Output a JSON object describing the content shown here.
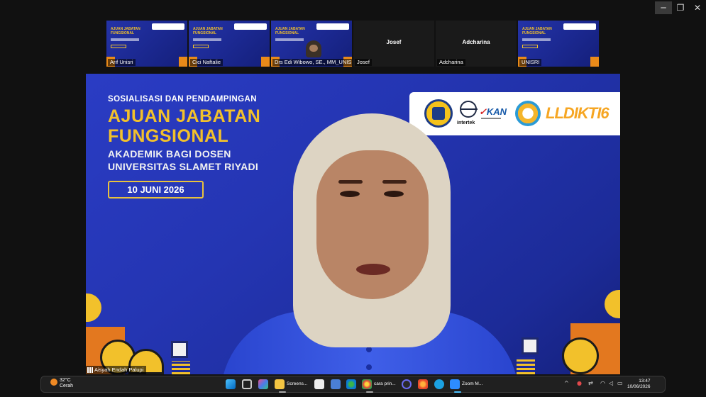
{
  "window_controls": {
    "minimize": "─",
    "restore": "❐",
    "close": "✕"
  },
  "gallery": [
    {
      "name": "Arif Unisri"
    },
    {
      "name": "Cici Naftalie"
    },
    {
      "name": "Drs Edi Wibowo, SE., MM_UNISRI"
    },
    {
      "name": "Josef",
      "display": "Josef"
    },
    {
      "name": "Adcharina",
      "display": "Adcharina"
    },
    {
      "name": "UNISRI"
    }
  ],
  "slide": {
    "kicker": "SOSIALISASI DAN PENDAMPINGAN",
    "title_line1": "AJUAN JABATAN",
    "title_line2": "FUNGSIONAL",
    "sub_line1": "AKADEMIK BAGI DOSEN",
    "sub_line2": "UNIVERSITAS SLAMET RIYADI",
    "date": "10 JUNI 2026",
    "logo_intertek": "intertek",
    "logo_kan": "KAN",
    "logo_lldikti": "LLDIKTI6"
  },
  "speaker": {
    "name": "Aisyah Endah Palupi"
  },
  "colors": {
    "slide_blue": "#2435b2",
    "accent_yellow": "#f2c12b",
    "accent_orange": "#e3781f"
  },
  "taskbar": {
    "weather": {
      "temp": "32°C",
      "condition": "Cerah"
    },
    "apps": [
      {
        "label": "Screens..."
      },
      {
        "label": "cara prin..."
      },
      {
        "label": "Zoom M..."
      }
    ],
    "tray_chevron": "^",
    "time": "13:47",
    "date": "10/06/2026"
  }
}
